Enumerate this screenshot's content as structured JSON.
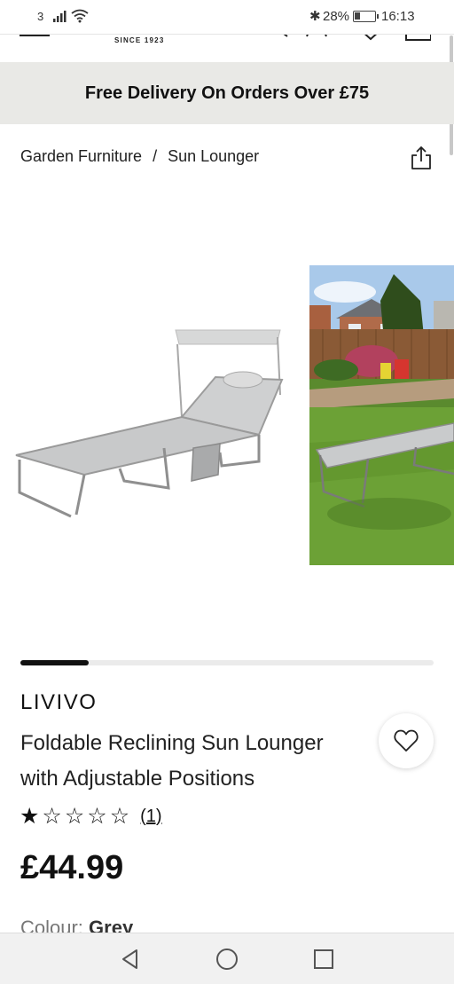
{
  "status_bar": {
    "carrier": "3",
    "battery_text": "28%",
    "battery_level": 0.28,
    "time": "16:13",
    "icons": [
      "signal-icon",
      "wifi-icon",
      "bluetooth-icon",
      "battery-icon"
    ]
  },
  "header": {
    "since": "SINCE 1923",
    "icons": [
      "menu-icon",
      "search-icon",
      "account-icon",
      "wishlist-icon",
      "bag-icon"
    ]
  },
  "promo": {
    "text": "Free Delivery On Orders Over £75"
  },
  "breadcrumb": {
    "items": [
      "Garden Furniture",
      "Sun Lounger"
    ],
    "separator": "/",
    "share_icon": "share-icon"
  },
  "gallery": {
    "images": [
      "sun-lounger-product-image",
      "sun-lounger-garden-image"
    ],
    "progress": 0.165
  },
  "product": {
    "brand": "LIVIVO",
    "title": "Foldable Reclining Sun Lounger with Adjustable Positions",
    "rating": 1,
    "rating_max": 5,
    "rating_count": "(1)",
    "price": "£44.99",
    "colour_label": "Colour:",
    "colour_value": "Grey"
  },
  "navbar": {
    "icons": [
      "back-icon",
      "home-icon",
      "recents-icon"
    ]
  },
  "colors": {
    "promo_bg": "#e9e9e6",
    "text": "#111111",
    "navbar_bg": "#f1f1f1"
  }
}
